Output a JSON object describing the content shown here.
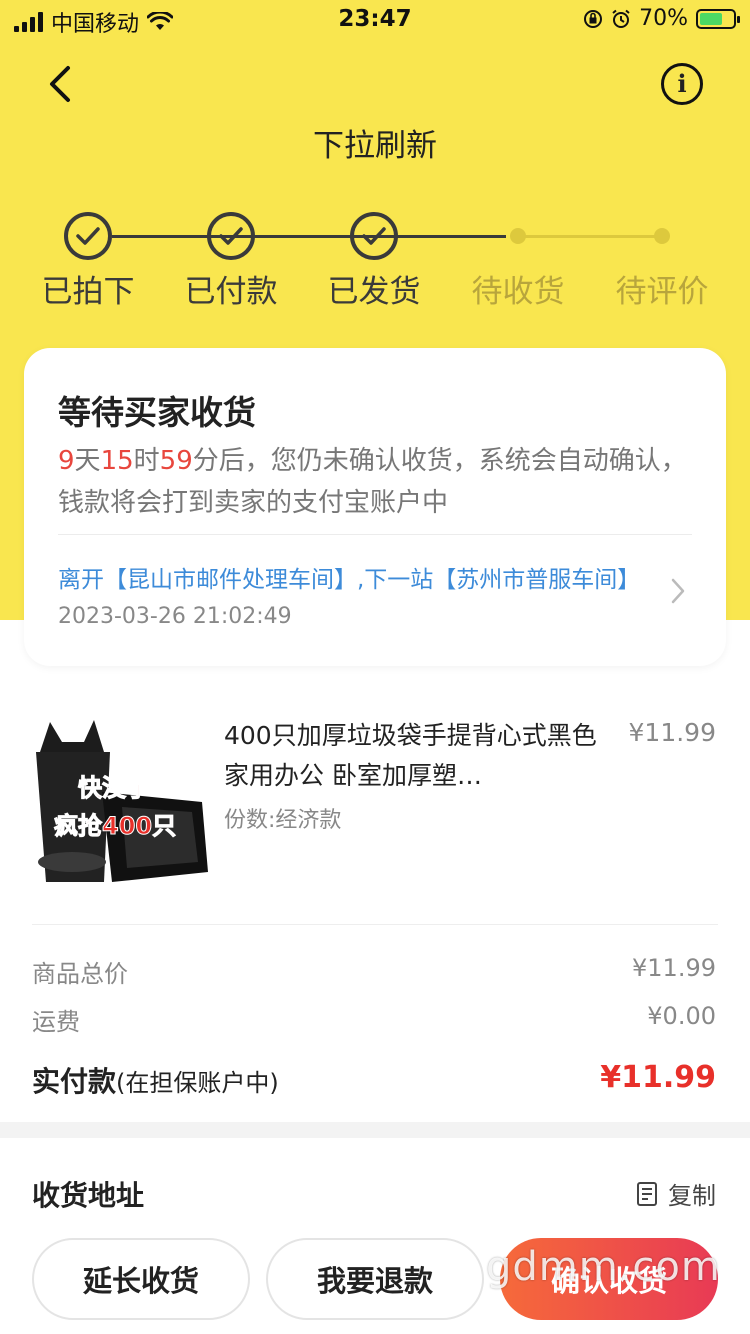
{
  "status_bar": {
    "carrier": "中国移动",
    "time": "23:47",
    "battery": "70%",
    "battery_level": 0.7
  },
  "header": {
    "title": "下拉刷新"
  },
  "steps": [
    {
      "label": "已拍下",
      "done": true
    },
    {
      "label": "已付款",
      "done": true
    },
    {
      "label": "已发货",
      "done": true
    },
    {
      "label": "待收货",
      "done": false
    },
    {
      "label": "待评价",
      "done": false
    }
  ],
  "status_card": {
    "title": "等待买家收货",
    "days": "9",
    "days_unit": "天",
    "hours": "15",
    "hours_unit": "时",
    "minutes": "59",
    "desc_rest": "分后，您仍未确认收货，系统会自动确认，钱款将会打到卖家的支付宝账户中",
    "logistics": "离开【昆山市邮件处理车间】,下一站【苏州市普服车间】",
    "logistics_time": "2023-03-26 21:02:49"
  },
  "product": {
    "title": "400只加厚垃圾袋手提背心式黑色家用办公 卧室加厚塑…",
    "price": "¥11.99",
    "spec": "份数:经济款",
    "image_text_1": "快没了",
    "image_text_2": "疯抢400只"
  },
  "summary": {
    "goods_label": "商品总价",
    "goods_value": "¥11.99",
    "shipping_label": "运费",
    "shipping_value": "¥0.00",
    "paid_label": "实付款",
    "paid_note": "(在担保账户中)",
    "paid_value": "¥11.99"
  },
  "address": {
    "title": "收货地址",
    "copy_label": "复制"
  },
  "actions": {
    "extend": "延长收货",
    "refund": "我要退款",
    "confirm": "确认收货"
  },
  "watermark": "gdmm.com",
  "colors": {
    "header_bg": "#f9e64f",
    "accent_red": "#e8302a",
    "link_blue": "#3d8bd9"
  }
}
